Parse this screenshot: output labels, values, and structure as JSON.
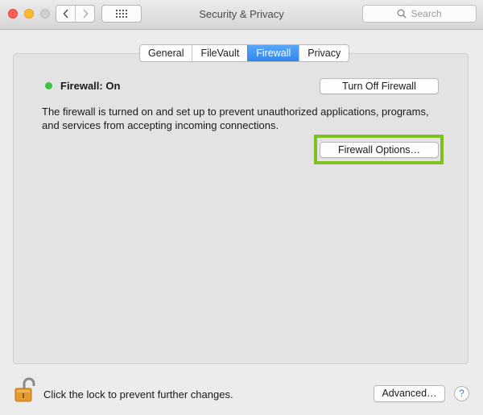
{
  "window": {
    "title": "Security & Privacy"
  },
  "search": {
    "placeholder": "Search"
  },
  "tabs": [
    {
      "label": "General",
      "active": false
    },
    {
      "label": "FileVault",
      "active": false
    },
    {
      "label": "Firewall",
      "active": true
    },
    {
      "label": "Privacy",
      "active": false
    }
  ],
  "firewall": {
    "status_label": "Firewall: On",
    "status_color": "#3ec140",
    "turn_off_label": "Turn Off Firewall",
    "description": "The firewall is turned on and set up to prevent unauthorized applications, programs, and services from accepting incoming connections.",
    "options_label": "Firewall Options…",
    "highlight_color": "#7fbf1f"
  },
  "footer": {
    "lock_text": "Click the lock to prevent further changes.",
    "advanced_label": "Advanced…",
    "help_label": "?"
  },
  "icons": [
    "close-icon",
    "minimize-icon",
    "maximize-icon",
    "chevron-left-icon",
    "chevron-right-icon",
    "grid-icon",
    "search-icon",
    "lock-icon"
  ]
}
